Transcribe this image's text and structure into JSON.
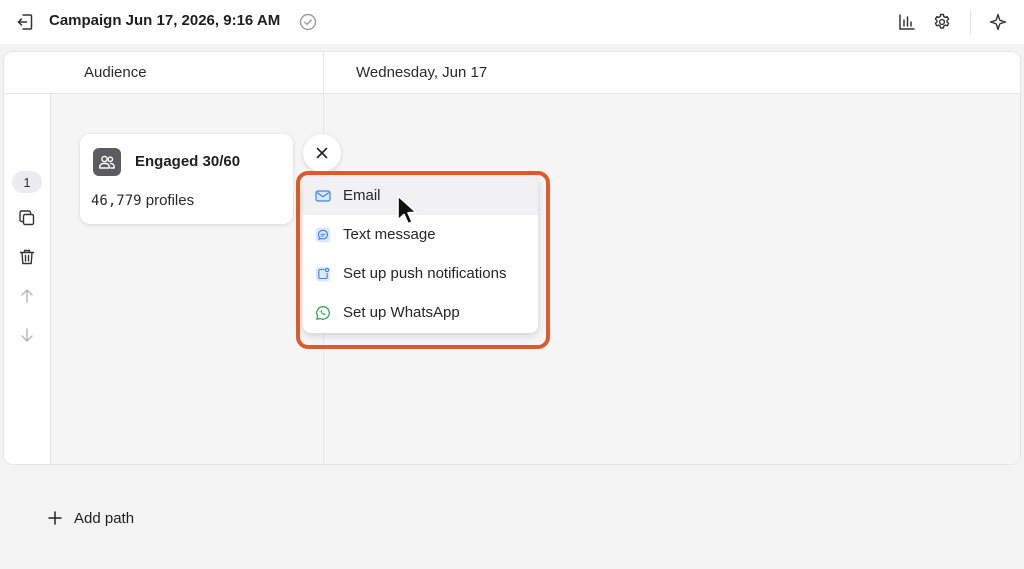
{
  "header": {
    "title": "Campaign Jun 17, 2026, 9:16 AM",
    "back_icon": "exit-left-icon",
    "saved_icon": "check-circle-icon",
    "actions": [
      {
        "name": "analytics",
        "icon": "bar-chart-icon"
      },
      {
        "name": "settings",
        "icon": "gear-icon"
      },
      {
        "name": "ai-assistant",
        "icon": "sparkle-icon"
      }
    ]
  },
  "columns": {
    "audience": "Audience",
    "day": "Wednesday, Jun 17"
  },
  "path": {
    "number": "1"
  },
  "segment": {
    "name": "Engaged 30/60",
    "count": "46,779",
    "count_suffix": " profiles",
    "icon": "people-icon"
  },
  "channel_menu": {
    "items": [
      {
        "label": "Email",
        "icon": "email-icon",
        "color": "#3b82f6"
      },
      {
        "label": "Text message",
        "icon": "chat-bubble-icon",
        "color": "#3b82f6"
      },
      {
        "label": "Set up push notifications",
        "icon": "push-notification-icon",
        "color": "#3b82f6"
      },
      {
        "label": "Set up WhatsApp",
        "icon": "whatsapp-icon",
        "color": "#25a244"
      }
    ],
    "highlight_color": "#e05a2c"
  },
  "footer": {
    "add_path_label": "Add path"
  }
}
